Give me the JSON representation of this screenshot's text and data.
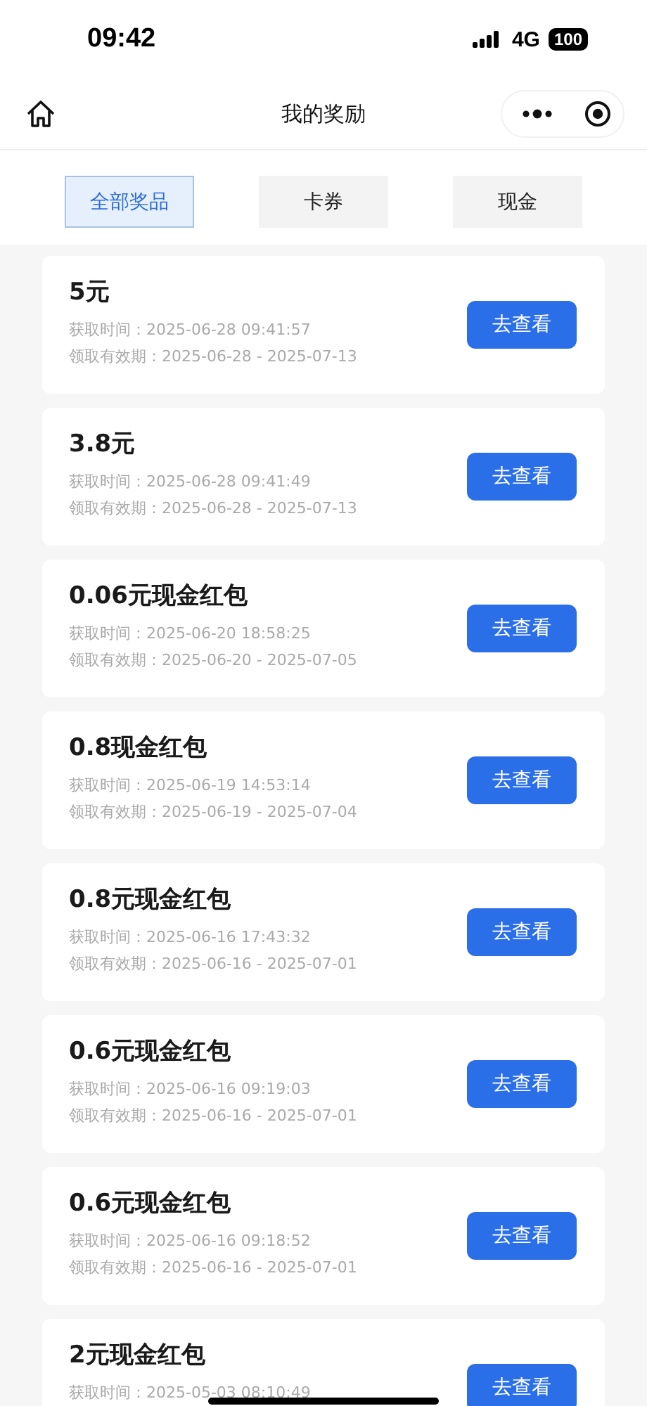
{
  "status_bar": {
    "time": "09:42",
    "network": "4G",
    "battery": "100"
  },
  "nav": {
    "title": "我的奖励"
  },
  "tabs": [
    {
      "label": "全部奖品",
      "selected": true
    },
    {
      "label": "卡券",
      "selected": false
    },
    {
      "label": "现金",
      "selected": false
    }
  ],
  "rewards": [
    {
      "title": "5元",
      "obtained": "获取时间：2025-06-28 09:41:57",
      "validity": "领取有效期：2025-06-28 - 2025-07-13",
      "button": "去查看"
    },
    {
      "title": "3.8元",
      "obtained": "获取时间：2025-06-28 09:41:49",
      "validity": "领取有效期：2025-06-28 - 2025-07-13",
      "button": "去查看"
    },
    {
      "title": "0.06元现金红包",
      "obtained": "获取时间：2025-06-20 18:58:25",
      "validity": "领取有效期：2025-06-20 - 2025-07-05",
      "button": "去查看"
    },
    {
      "title": "0.8现金红包",
      "obtained": "获取时间：2025-06-19 14:53:14",
      "validity": "领取有效期：2025-06-19 - 2025-07-04",
      "button": "去查看"
    },
    {
      "title": "0.8元现金红包",
      "obtained": "获取时间：2025-06-16 17:43:32",
      "validity": "领取有效期：2025-06-16 - 2025-07-01",
      "button": "去查看"
    },
    {
      "title": "0.6元现金红包",
      "obtained": "获取时间：2025-06-16 09:19:03",
      "validity": "领取有效期：2025-06-16 - 2025-07-01",
      "button": "去查看"
    },
    {
      "title": "0.6元现金红包",
      "obtained": "获取时间：2025-06-16 09:18:52",
      "validity": "领取有效期：2025-06-16 - 2025-07-01",
      "button": "去查看"
    },
    {
      "title": "2元现金红包",
      "obtained": "获取时间：2025-05-03 08:10:49",
      "button": "去查看"
    }
  ]
}
